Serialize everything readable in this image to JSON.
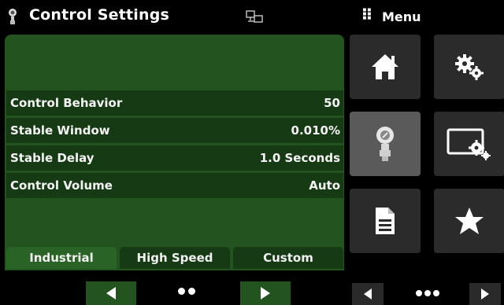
{
  "header": {
    "title": "Control Settings",
    "menu_label": "Menu"
  },
  "settings": [
    {
      "label": "Control Behavior",
      "value": "50"
    },
    {
      "label": "Stable Window",
      "value": "0.010%"
    },
    {
      "label": "Stable Delay",
      "value": "1.0 Seconds"
    },
    {
      "label": "Control Volume",
      "value": "Auto"
    }
  ],
  "modes": [
    "Industrial",
    "High Speed",
    "Custom"
  ],
  "pager": {
    "left_pages": 2,
    "right_pages": 3
  },
  "menu_tiles": [
    "home-icon",
    "settings-gears-icon",
    "transducer-icon",
    "display-settings-icon",
    "document-icon",
    "star-icon"
  ],
  "colors": {
    "panel": "#23541f",
    "row": "#163a14",
    "tile": "#2b2b2b",
    "tile_selected": "#5a5a5a"
  }
}
